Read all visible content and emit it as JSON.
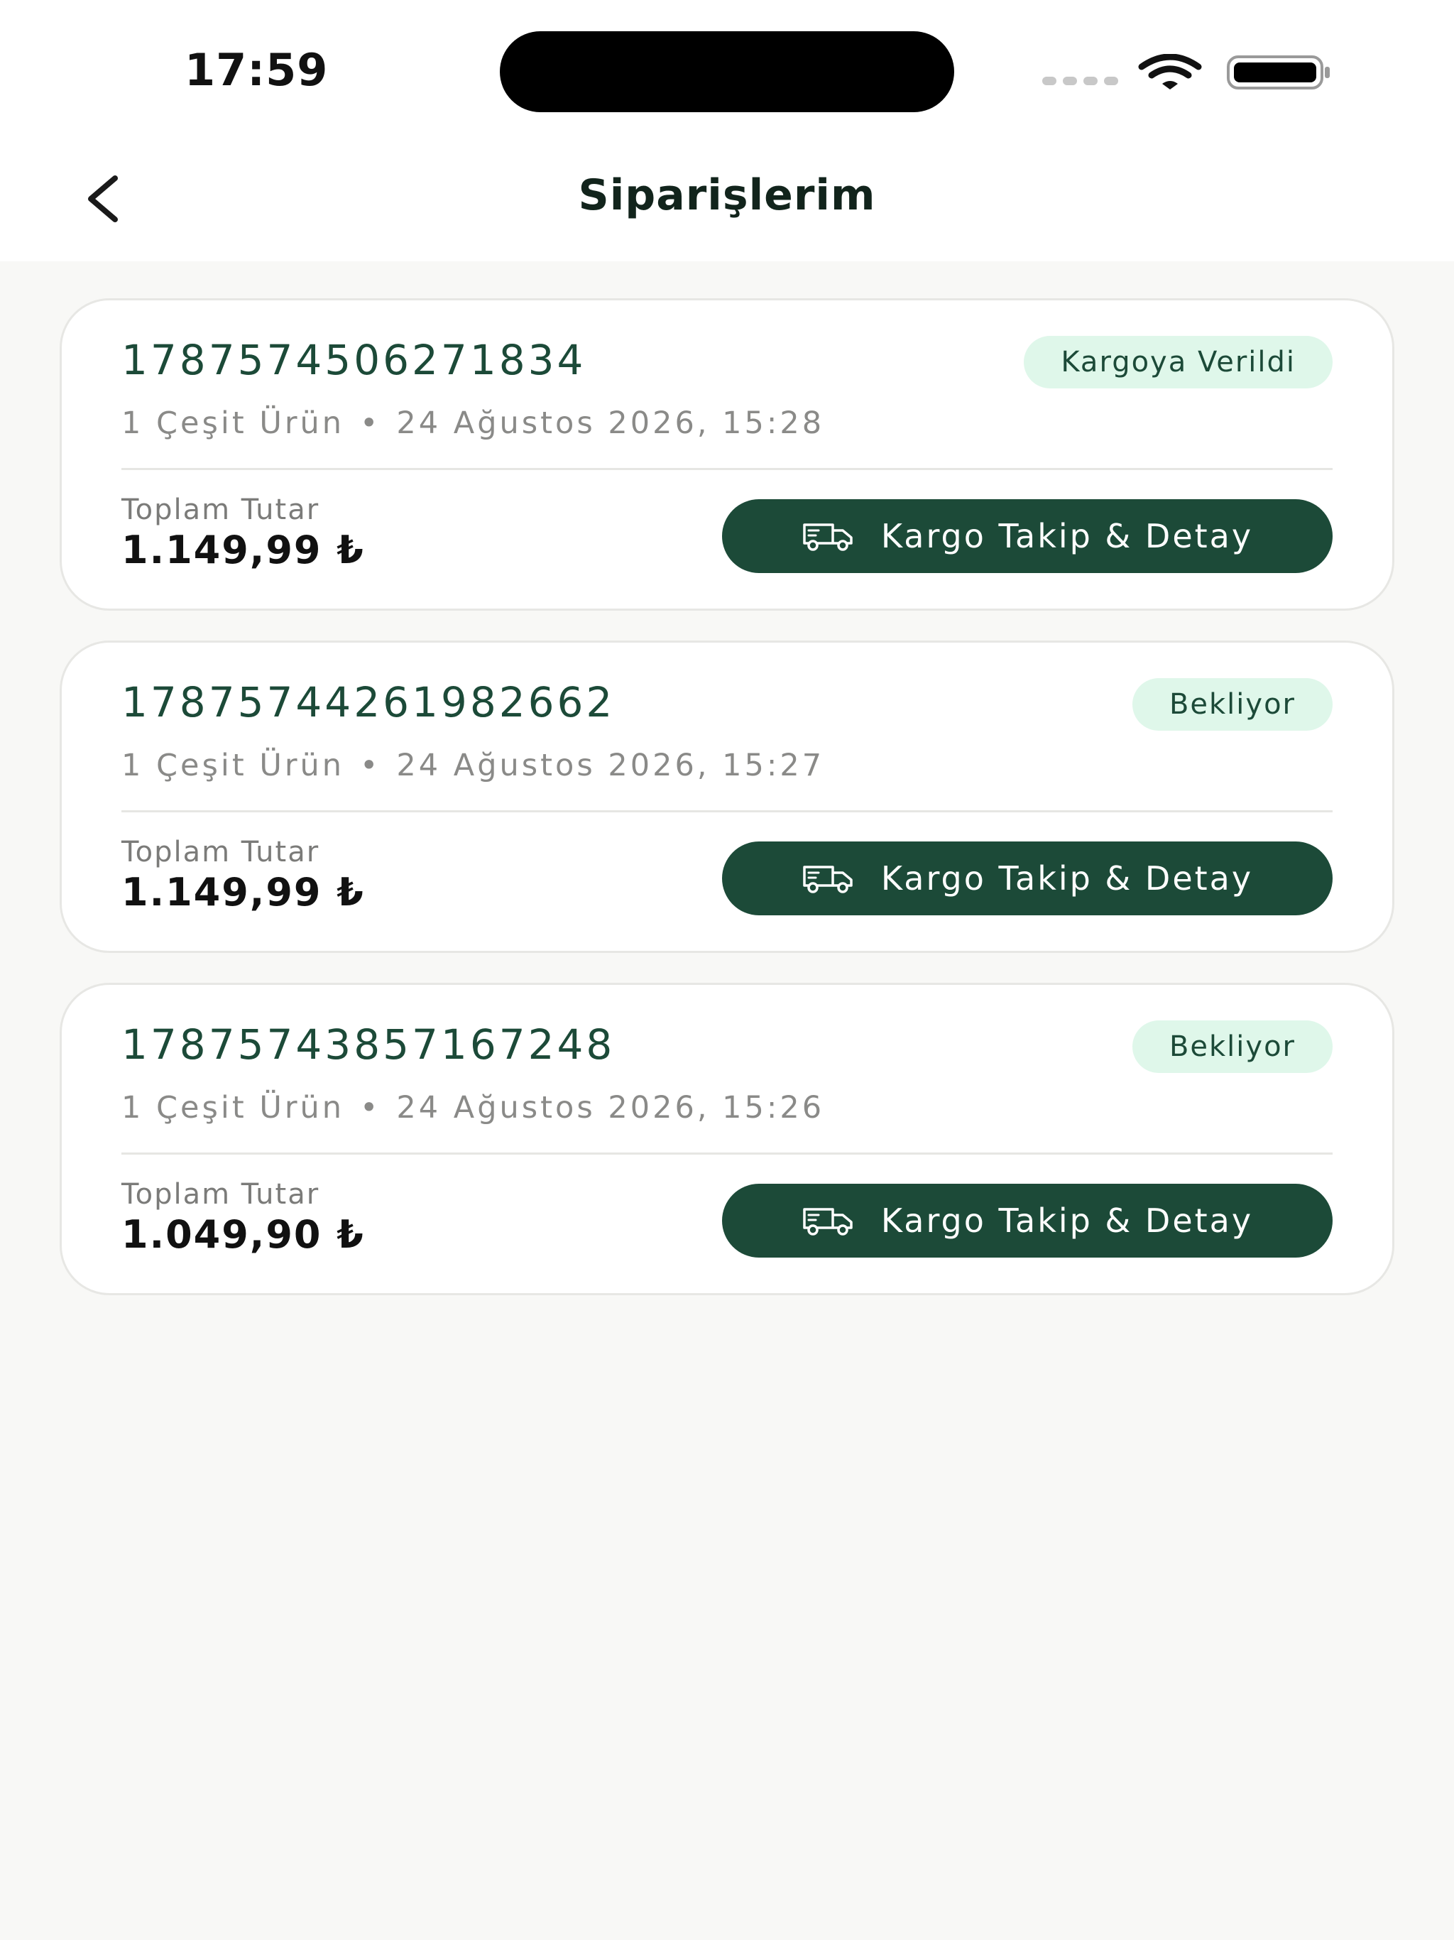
{
  "status_bar": {
    "time": "17:59"
  },
  "header": {
    "title": "Siparişlerim"
  },
  "colors": {
    "accent": "#1c4a38",
    "badge_bg": "#dff7ea",
    "background": "#f8f8f6"
  },
  "icons": {
    "back": "chevron-left-icon",
    "button": "truck-icon"
  },
  "orders": [
    {
      "id": "1787574506271834",
      "status": "Kargoya Verildi",
      "items": "1 Çeşit Ürün",
      "date": "24 Ağustos 2026, 15:28",
      "total_label": "Toplam Tutar",
      "total": "1.149,99 ₺",
      "button_label": "Kargo Takip & Detay"
    },
    {
      "id": "17875744261982662",
      "status": "Bekliyor",
      "items": "1 Çeşit Ürün",
      "date": "24 Ağustos 2026, 15:27",
      "total_label": "Toplam Tutar",
      "total": "1.149,99 ₺",
      "button_label": "Kargo Takip & Detay"
    },
    {
      "id": "17875743857167248",
      "status": "Bekliyor",
      "items": "1 Çeşit Ürün",
      "date": "24 Ağustos 2026, 15:26",
      "total_label": "Toplam Tutar",
      "total": "1.049,90 ₺",
      "button_label": "Kargo Takip & Detay"
    }
  ]
}
